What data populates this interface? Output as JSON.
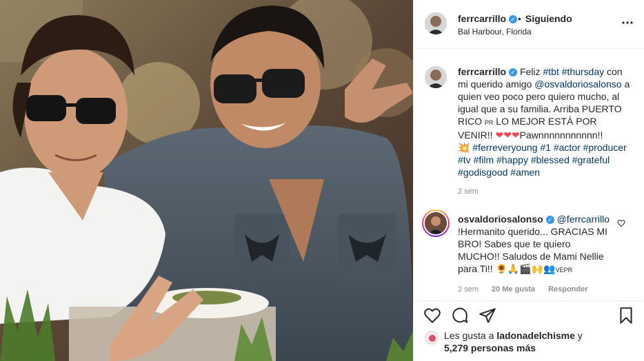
{
  "post": {
    "username": "ferrcarrillo",
    "separator": "•",
    "follow_status": "Siguiendo",
    "location": "Bal Harbour, Florida",
    "verified_mark": "✓"
  },
  "caption": {
    "username": "ferrcarrillo",
    "text_1": "Feliz ",
    "tag_tbt": "#tbt",
    "tag_thursday": "#thursday",
    "text_2": " con mi querido amigo ",
    "mention": "@osvaldoriosalonso",
    "text_3": " a quien veo poco pero quiero mucho, al igual que a su familia. Arriba PUERTO RICO ",
    "pr_flag": "PR",
    "text_4": " LO MEJOR ESTÁ POR VENIR!! ",
    "hearts": "❤❤❤",
    "text_5": "Pawnnnnnnnnnnn!!",
    "burst": "💥",
    "tags_line": "#ferreveryoung #1 #actor #producer #tv #film #happy #blessed #grateful #godisgood #amen",
    "time": "2 sem"
  },
  "comment": {
    "username": "osvaldoriosalonso",
    "mention": "@ferrcarrillo",
    "text": "!Hermanito querido... GRACIAS MI BRO! Sabes que te quiero MUCHO!! Saludos de Mami Nellie para Ti!!",
    "emojis": "🌻🙏🎬🙌👥",
    "flag_text": "VEPR",
    "time": "2 sem",
    "likes": "20 Me gusta",
    "reply": "Responder"
  },
  "likes": {
    "prefix": "Les gusta a ",
    "user": "ladonadelchisme",
    "middle": " y",
    "count": "5,279 personas más"
  },
  "colors": {
    "link": "#00376b",
    "muted": "#8e8e8e",
    "verified": "#3897f0",
    "heart": "#ed4956"
  }
}
